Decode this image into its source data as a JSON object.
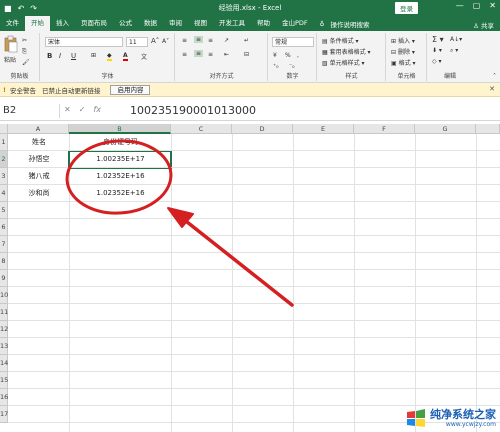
{
  "titlebar": {
    "title": "经验用.xlsx - Excel",
    "login_label": "登录",
    "minimize": "—",
    "restore": "▢",
    "close": "✕",
    "save_icon": "save-icon",
    "undo_icon": "undo-icon",
    "redo_icon": "redo-icon"
  },
  "tabs": {
    "file": "文件",
    "home": "开始",
    "insert": "插入",
    "layout": "页面布局",
    "formulas": "公式",
    "data": "数据",
    "review": "审阅",
    "view": "视图",
    "developer": "开发工具",
    "help": "帮助",
    "wps_pdf": "金山PDF",
    "search": "操作说明搜索",
    "share": "共享"
  },
  "ribbon": {
    "clipboard": {
      "label": "剪贴板",
      "paste": "粘贴"
    },
    "font": {
      "label": "字体",
      "font_name": "宋体",
      "font_size": "11",
      "bold": "B",
      "italic": "I",
      "underline": "U",
      "grow": "A",
      "shrink": "A",
      "wen": "文"
    },
    "alignment": {
      "label": "对齐方式"
    },
    "number": {
      "label": "数字",
      "format": "常规",
      "percent": "%",
      "comma": ","
    },
    "styles": {
      "label": "样式",
      "conditional": "条件格式",
      "table": "套用表格格式",
      "cell": "单元格样式"
    },
    "cells": {
      "label": "单元格",
      "insert": "插入",
      "delete": "删除",
      "format": "格式"
    },
    "editing": {
      "label": "编辑",
      "sum": "Σ"
    }
  },
  "security_bar": {
    "title": "安全警告",
    "message": "已禁止自动更新链接",
    "button": "启用内容",
    "close": "✕"
  },
  "formula_bar": {
    "name_box": "B2",
    "cancel": "✕",
    "enter": "✓",
    "fx": "fx",
    "value": "100235190001013000"
  },
  "grid": {
    "columns": [
      "A",
      "B",
      "C",
      "D",
      "E",
      "F",
      "G"
    ],
    "rows": [
      "1",
      "2",
      "3",
      "4",
      "5",
      "6",
      "7",
      "8",
      "9",
      "10",
      "11",
      "12",
      "13",
      "14",
      "15",
      "16",
      "17"
    ],
    "header_a": "姓名",
    "header_b": "身份证号码",
    "names": [
      "孙悟空",
      "猪八戒",
      "沙和尚"
    ],
    "ids": [
      "1.00235E+17",
      "1.02352E+16",
      "1.02352E+16"
    ]
  },
  "colors": {
    "excel_green": "#217346",
    "annotation_red": "#d42020"
  },
  "watermark": {
    "text": "纯净系统之家",
    "url": "www.ycwjzy.com"
  }
}
